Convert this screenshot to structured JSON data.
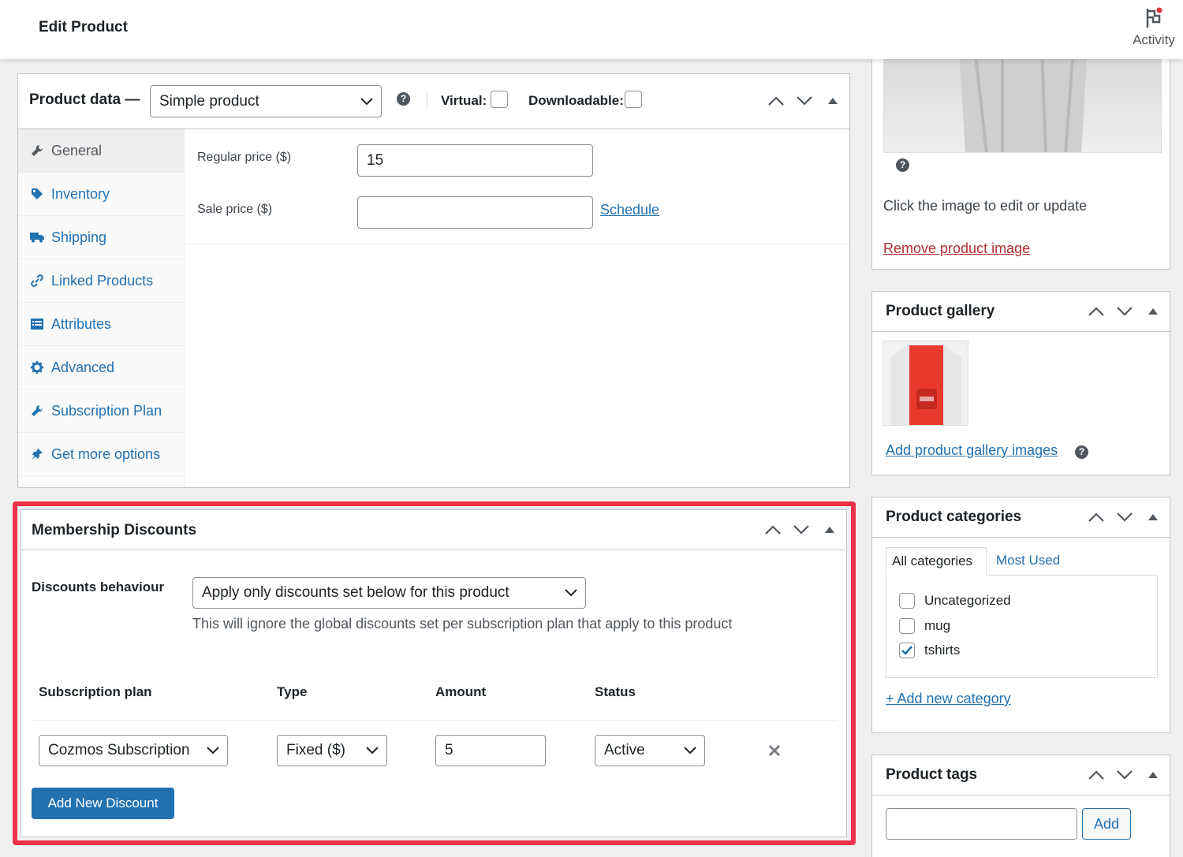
{
  "header": {
    "title": "Edit Product",
    "activity_label": "Activity"
  },
  "product_data": {
    "title": "Product data —",
    "type_select": "Simple product",
    "virtual_label": "Virtual:",
    "downloadable_label": "Downloadable:",
    "tabs": [
      {
        "label": "General",
        "icon": "wrench-icon"
      },
      {
        "label": "Inventory",
        "icon": "tag-icon"
      },
      {
        "label": "Shipping",
        "icon": "truck-icon"
      },
      {
        "label": "Linked Products",
        "icon": "link-icon"
      },
      {
        "label": "Attributes",
        "icon": "list-icon"
      },
      {
        "label": "Advanced",
        "icon": "gear-icon"
      },
      {
        "label": "Subscription Plan",
        "icon": "wrench-icon"
      },
      {
        "label": "Get more options",
        "icon": "plugin-icon"
      }
    ],
    "regular_price_label": "Regular price ($)",
    "regular_price_value": "15",
    "sale_price_label": "Sale price ($)",
    "sale_price_value": "",
    "schedule_link": "Schedule"
  },
  "membership_discounts": {
    "title": "Membership Discounts",
    "behaviour_label": "Discounts behaviour",
    "behaviour_value": "Apply only discounts set below for this product",
    "behaviour_note": "This will ignore the global discounts set per subscription plan that apply to this product",
    "columns": [
      "Subscription plan",
      "Type",
      "Amount",
      "Status"
    ],
    "row": {
      "plan": "Cozmos Subscription",
      "type": "Fixed ($)",
      "amount": "5",
      "status": "Active"
    },
    "add_button": "Add New Discount",
    "highlight_color": "#f0314a"
  },
  "product_image": {
    "note": "Click the image to edit or update",
    "remove_link": "Remove product image"
  },
  "product_gallery": {
    "title": "Product gallery",
    "add_link": "Add product gallery images"
  },
  "product_categories": {
    "title": "Product categories",
    "tab_all": "All categories",
    "tab_most_used": "Most Used",
    "items": [
      {
        "label": "Uncategorized",
        "checked": false
      },
      {
        "label": "mug",
        "checked": false
      },
      {
        "label": "tshirts",
        "checked": true
      }
    ],
    "add_link": "+ Add new category"
  },
  "product_tags": {
    "title": "Product tags",
    "input_value": "",
    "add_button": "Add"
  },
  "colors": {
    "link": "#2271b1",
    "danger": "#b32d2e",
    "accent": "#2271b1"
  }
}
